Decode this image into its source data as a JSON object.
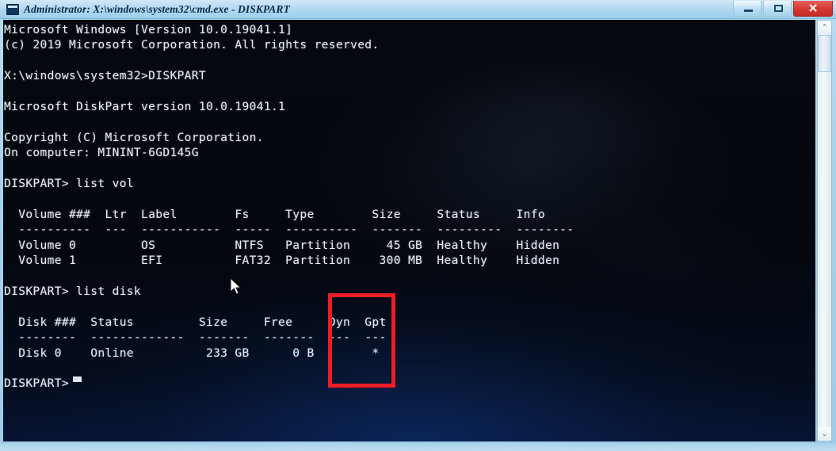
{
  "window": {
    "title": "Administrator: X:\\windows\\system32\\cmd.exe - DISKPART",
    "app_icon": "cmd-console-icon",
    "buttons": {
      "minimize_label": "Minimize",
      "maximize_label": "Maximize",
      "close_label": "✕"
    },
    "accent_color": "#9ecbe8",
    "close_color": "#d63a34"
  },
  "annotation": {
    "highlight_color": "#ef1c24",
    "target_column": "Gpt",
    "note": "red-rectangle-highlight around Gpt column"
  },
  "scrollbar": {
    "up_arrow": "⌃",
    "down_arrow": "⌄"
  },
  "console": {
    "prompt": "DISKPART>",
    "cursor": "block-cursor",
    "text": "Microsoft Windows [Version 10.0.19041.1]\n(c) 2019 Microsoft Corporation. All rights reserved.\n\nX:\\windows\\system32>DISKPART\n\nMicrosoft DiskPart version 10.0.19041.1\n\nCopyright (C) Microsoft Corporation.\nOn computer: MININT-6GD145G\n\nDISKPART> list vol\n\n  Volume ###  Ltr  Label        Fs     Type        Size     Status     Info\n  ----------  ---  -----------  -----  ----------  -------  ---------  --------\n  Volume 0         OS           NTFS   Partition     45 GB  Healthy    Hidden\n  Volume 1         EFI          FAT32  Partition    300 MB  Healthy    Hidden\n\nDISKPART> list disk\n\n  Disk ###  Status         Size     Free     Dyn  Gpt\n  --------  -------------  -------  -------  ---  ---\n  Disk 0    Online          233 GB      0 B        *\n\nDISKPART> "
  },
  "console_lines": [
    "Microsoft Windows [Version 10.0.19041.1]",
    "(c) 2019 Microsoft Corporation. All rights reserved.",
    "",
    "X:\\windows\\system32>DISKPART",
    "",
    "Microsoft DiskPart version 10.0.19041.1",
    "",
    "Copyright (C) Microsoft Corporation.",
    "On computer: MININT-6GD145G",
    "",
    "DISKPART> list vol",
    "",
    "  Volume ###  Ltr  Label        Fs     Type        Size     Status     Info",
    "  ----------  ---  -----------  -----  ----------  -------  ---------  --------",
    "  Volume 0         OS           NTFS   Partition     45 GB  Healthy    Hidden",
    "  Volume 1         EFI          FAT32  Partition    300 MB  Healthy    Hidden",
    "",
    "DISKPART> list disk",
    "",
    "  Disk ###  Status         Size     Free     Dyn  Gpt",
    "  --------  -------------  -------  -------  ---  ---",
    "  Disk 0    Online          233 GB      0 B        *",
    "",
    "DISKPART> "
  ],
  "volume_table": {
    "headers": [
      "Volume ###",
      "Ltr",
      "Label",
      "Fs",
      "Type",
      "Size",
      "Status",
      "Info"
    ],
    "rows": [
      [
        "Volume 0",
        "",
        "OS",
        "NTFS",
        "Partition",
        "45 GB",
        "Healthy",
        "Hidden"
      ],
      [
        "Volume 1",
        "",
        "EFI",
        "FAT32",
        "Partition",
        "300 MB",
        "Healthy",
        "Hidden"
      ]
    ]
  },
  "disk_table": {
    "headers": [
      "Disk ###",
      "Status",
      "Size",
      "Free",
      "Dyn",
      "Gpt"
    ],
    "rows": [
      [
        "Disk 0",
        "Online",
        "233 GB",
        "0 B",
        "",
        "*"
      ]
    ]
  },
  "commands": [
    "DISKPART",
    "list vol",
    "list disk"
  ],
  "system": {
    "windows_version": "10.0.19041.1",
    "diskpart_version": "10.0.19041.1",
    "computer_name": "MININT-6GD145G",
    "copyright": "(c) 2019 Microsoft Corporation. All rights reserved."
  }
}
